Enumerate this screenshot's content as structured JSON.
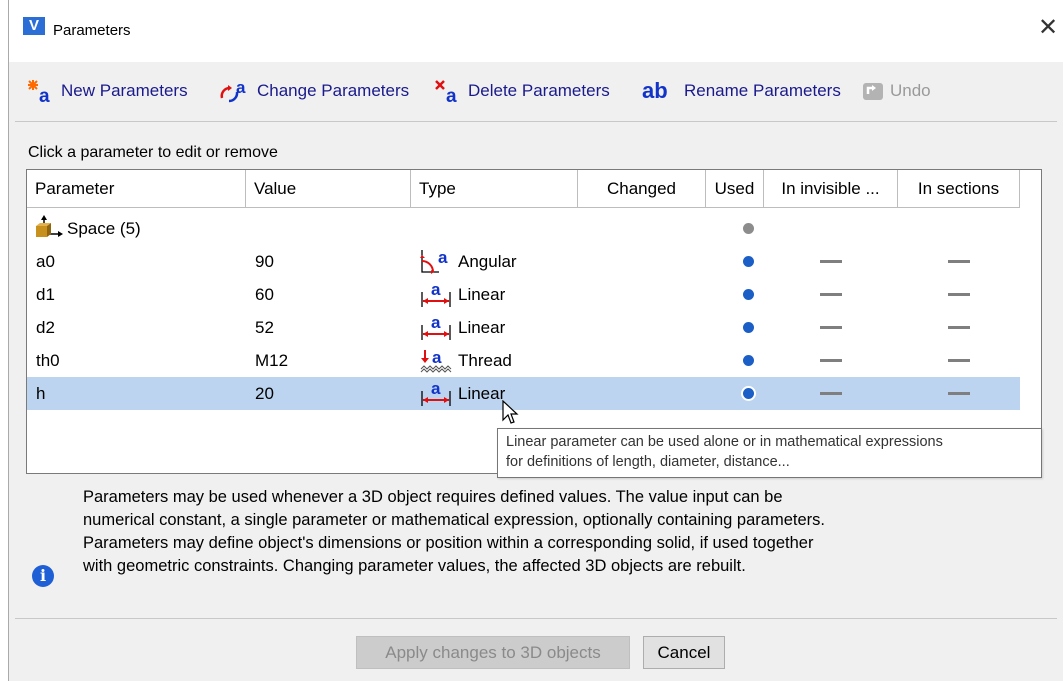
{
  "window": {
    "title": "Parameters",
    "close_glyph": "✕"
  },
  "toolbar": {
    "new_label": "New Parameters",
    "change_label": "Change Parameters",
    "delete_label": "Delete Parameters",
    "rename_label": "Rename Parameters",
    "undo_label": "Undo",
    "rename_icon_text": "ab"
  },
  "hint": "Click a parameter to edit or remove",
  "table": {
    "columns": [
      "Parameter",
      "Value",
      "Type",
      "Changed",
      "Used",
      "In invisible ...",
      "In sections"
    ],
    "group": {
      "label": "Space (5)"
    },
    "rows": [
      {
        "name": "a0",
        "value": "90",
        "type": "Angular",
        "icon": "angular-icon",
        "used": true,
        "selected": false
      },
      {
        "name": "d1",
        "value": "60",
        "type": "Linear",
        "icon": "linear-icon",
        "used": true,
        "selected": false
      },
      {
        "name": "d2",
        "value": "52",
        "type": "Linear",
        "icon": "linear-icon",
        "used": true,
        "selected": false
      },
      {
        "name": "th0",
        "value": "M12",
        "type": "Thread",
        "icon": "thread-icon",
        "used": true,
        "selected": false
      },
      {
        "name": "h",
        "value": "20",
        "type": "Linear",
        "icon": "linear-icon",
        "used": true,
        "selected": true
      }
    ]
  },
  "tooltip": {
    "line1": "Linear parameter can be used alone or in mathematical expressions",
    "line2": "for definitions of length, diameter, distance..."
  },
  "info": {
    "line1": "Parameters may be used whenever a 3D object requires defined values. The value input can be",
    "line2": "numerical constant, a single parameter or mathematical expression, optionally containing parameters.",
    "line3": "Parameters may define  object's dimensions or position within a corresponding solid, if used together",
    "line4": "with geometric constraints. Changing parameter values, the affected 3D objects are rebuilt."
  },
  "buttons": {
    "apply_label": "Apply changes to 3D objects",
    "cancel_label": "Cancel"
  },
  "colors": {
    "accent": "#1233c8",
    "selection": "#bcd4ef",
    "dot_blue": "#1b5fc6",
    "info_blue": "#1f5fd6"
  }
}
